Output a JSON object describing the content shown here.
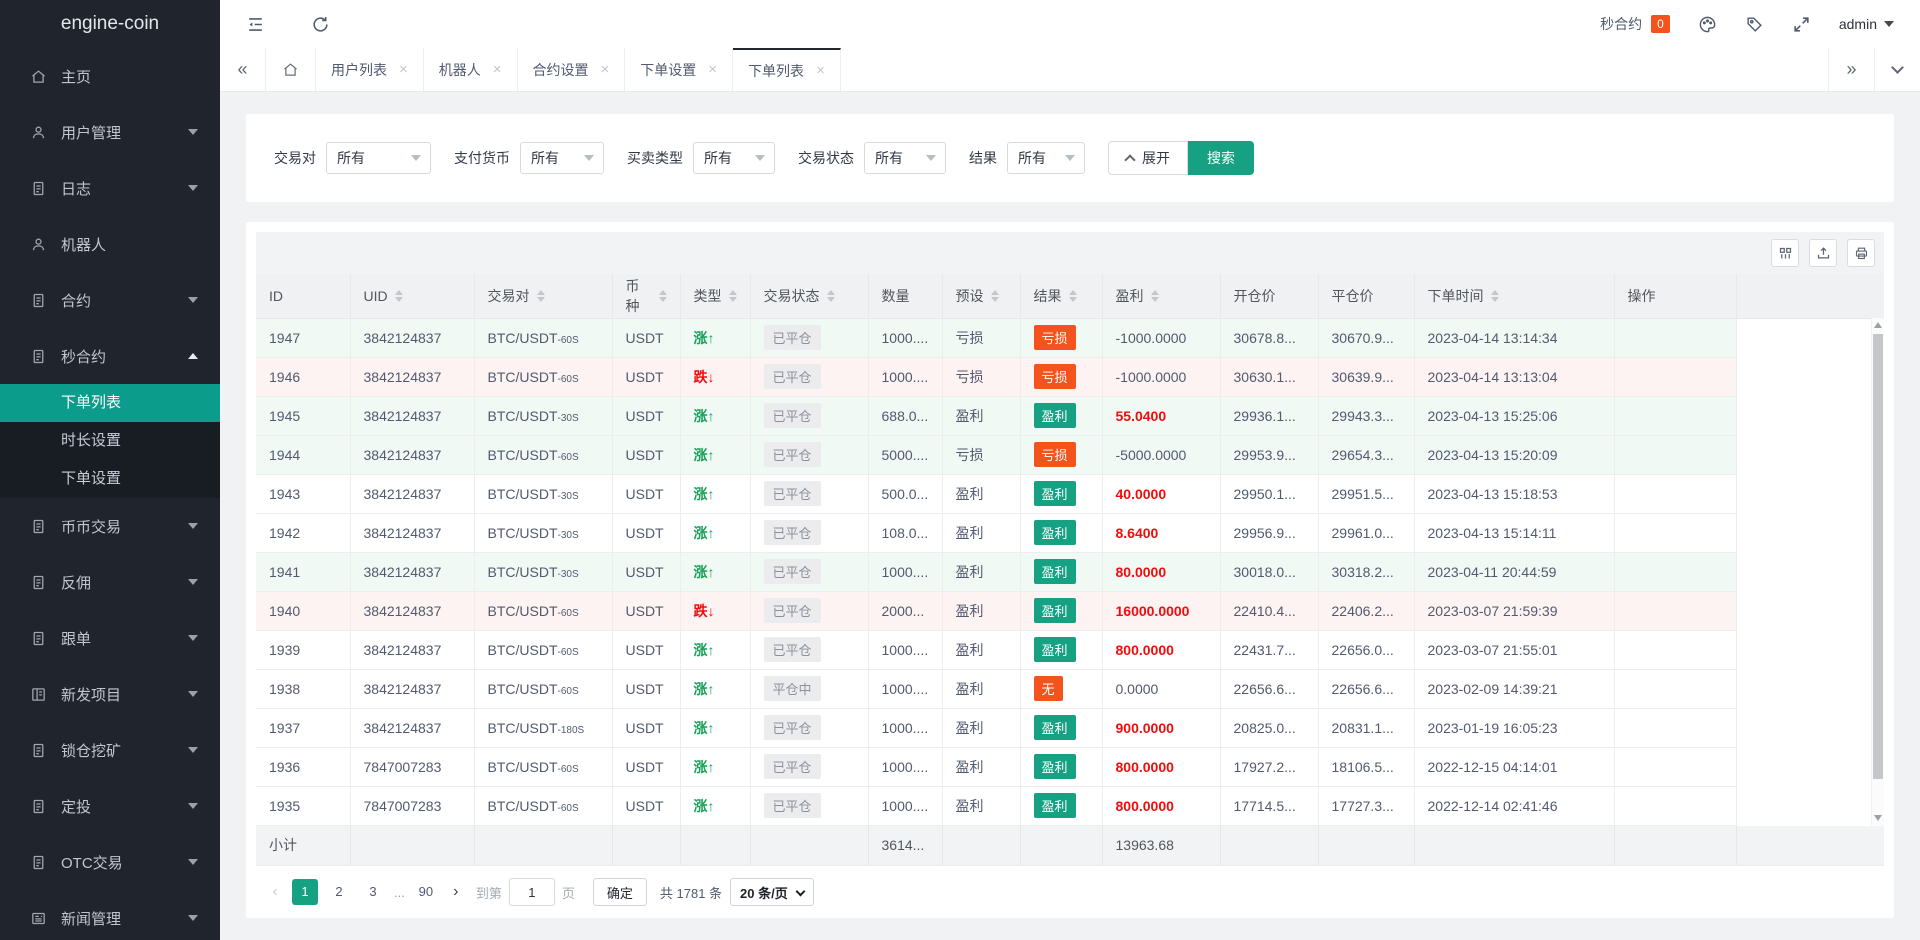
{
  "app": {
    "logo": "engine-coin"
  },
  "colors": {
    "teal": "#15a182",
    "sidebar_active": "#0c9c8c",
    "orange": "#f5531d",
    "red": "#f20c0c",
    "green": "#18a058",
    "tint_green": "#f0f9f4",
    "tint_pink": "#fdf3f2",
    "tab_active_bar": "#23262d"
  },
  "topbar": {
    "notice": {
      "label": "秒合约",
      "count": "0"
    },
    "user": {
      "name": "admin"
    }
  },
  "tabbar": {
    "tabs": [
      {
        "key": "user-list",
        "label": "用户列表",
        "active": false
      },
      {
        "key": "robots",
        "label": "机器人",
        "active": false
      },
      {
        "key": "contract-settings",
        "label": "合约设置",
        "active": false
      },
      {
        "key": "order-settings",
        "label": "下单设置",
        "active": false
      },
      {
        "key": "order-list",
        "label": "下单列表",
        "active": true
      }
    ]
  },
  "sidebar": {
    "items": [
      {
        "key": "home",
        "label": "主页",
        "icon": "home-icon",
        "expandable": false
      },
      {
        "key": "user-management",
        "label": "用户管理",
        "icon": "user-icon",
        "expandable": true
      },
      {
        "key": "logs",
        "label": "日志",
        "icon": "doc-icon",
        "expandable": true
      },
      {
        "key": "robots",
        "label": "机器人",
        "icon": "user-icon",
        "expandable": false
      },
      {
        "key": "contracts",
        "label": "合约",
        "icon": "doc-icon",
        "expandable": true
      },
      {
        "key": "second-contracts",
        "label": "秒合约",
        "icon": "doc-icon",
        "expandable": true,
        "expanded": true,
        "children": [
          {
            "key": "order-list",
            "label": "下单列表",
            "active": true
          },
          {
            "key": "duration-settings",
            "label": "时长设置",
            "active": false
          },
          {
            "key": "order-settings",
            "label": "下单设置",
            "active": false
          }
        ]
      },
      {
        "key": "spot-trading",
        "label": "币币交易",
        "icon": "doc-icon",
        "expandable": true
      },
      {
        "key": "rebate",
        "label": "反佣",
        "icon": "doc-icon",
        "expandable": true
      },
      {
        "key": "copy-trading",
        "label": "跟单",
        "icon": "doc-icon",
        "expandable": true
      },
      {
        "key": "new-projects",
        "label": "新发项目",
        "icon": "project-icon",
        "expandable": true
      },
      {
        "key": "lock-mining",
        "label": "锁仓挖矿",
        "icon": "doc-icon",
        "expandable": true
      },
      {
        "key": "auto-invest",
        "label": "定投",
        "icon": "doc-icon",
        "expandable": true
      },
      {
        "key": "otc-trading",
        "label": "OTC交易",
        "icon": "doc-icon",
        "expandable": true
      },
      {
        "key": "news-management",
        "label": "新闻管理",
        "icon": "news-icon",
        "expandable": true
      }
    ]
  },
  "filters": {
    "fields": [
      {
        "key": "pair",
        "label": "交易对",
        "value": "所有"
      },
      {
        "key": "pay-currency",
        "label": "支付货币",
        "value": "所有"
      },
      {
        "key": "trade-type",
        "label": "买卖类型",
        "value": "所有"
      },
      {
        "key": "trade-status",
        "label": "交易状态",
        "value": "所有"
      },
      {
        "key": "result",
        "label": "结果",
        "value": "所有"
      }
    ],
    "collapse_label": "展开",
    "search_label": "搜索"
  },
  "table": {
    "columns": [
      {
        "key": "id",
        "label": "ID",
        "sortable": false
      },
      {
        "key": "uid",
        "label": "UID",
        "sortable": true
      },
      {
        "key": "pair",
        "label": "交易对",
        "sortable": true
      },
      {
        "key": "coin",
        "label": "币种",
        "sortable": true
      },
      {
        "key": "type",
        "label": "类型",
        "sortable": true
      },
      {
        "key": "status",
        "label": "交易状态",
        "sortable": true
      },
      {
        "key": "amount",
        "label": "数量",
        "sortable": false
      },
      {
        "key": "preset",
        "label": "预设",
        "sortable": true
      },
      {
        "key": "result",
        "label": "结果",
        "sortable": true
      },
      {
        "key": "profit",
        "label": "盈利",
        "sortable": true
      },
      {
        "key": "open",
        "label": "开仓价",
        "sortable": false
      },
      {
        "key": "close",
        "label": "平仓价",
        "sortable": false
      },
      {
        "key": "time",
        "label": "下单时间",
        "sortable": true
      },
      {
        "key": "action",
        "label": "操作",
        "sortable": false
      }
    ],
    "rows": [
      {
        "id": "1947",
        "uid": "3842124837",
        "pair": "BTC/USDT",
        "period": "60S",
        "coin": "USDT",
        "type": "涨",
        "dir": "up",
        "status": "已平仓",
        "amount": "1000....",
        "preset": "亏损",
        "result": "亏损",
        "result_color": "orange",
        "profit": "-1000.0000",
        "profit_red": false,
        "open": "30678.8...",
        "close": "30670.9...",
        "time": "2023-04-14 13:14:34",
        "tint": "green"
      },
      {
        "id": "1946",
        "uid": "3842124837",
        "pair": "BTC/USDT",
        "period": "60S",
        "coin": "USDT",
        "type": "跌",
        "dir": "down",
        "status": "已平仓",
        "amount": "1000....",
        "preset": "亏损",
        "result": "亏损",
        "result_color": "orange",
        "profit": "-1000.0000",
        "profit_red": false,
        "open": "30630.1...",
        "close": "30639.9...",
        "time": "2023-04-14 13:13:04",
        "tint": "pink"
      },
      {
        "id": "1945",
        "uid": "3842124837",
        "pair": "BTC/USDT",
        "period": "30S",
        "coin": "USDT",
        "type": "涨",
        "dir": "up",
        "status": "已平仓",
        "amount": "688.0...",
        "preset": "盈利",
        "result": "盈利",
        "result_color": "teal",
        "profit": "55.0400",
        "profit_red": true,
        "open": "29936.1...",
        "close": "29943.3...",
        "time": "2023-04-13 15:25:06",
        "tint": "green"
      },
      {
        "id": "1944",
        "uid": "3842124837",
        "pair": "BTC/USDT",
        "period": "60S",
        "coin": "USDT",
        "type": "涨",
        "dir": "up",
        "status": "已平仓",
        "amount": "5000....",
        "preset": "亏损",
        "result": "亏损",
        "result_color": "orange",
        "profit": "-5000.0000",
        "profit_red": false,
        "open": "29953.9...",
        "close": "29654.3...",
        "time": "2023-04-13 15:20:09",
        "tint": "green"
      },
      {
        "id": "1943",
        "uid": "3842124837",
        "pair": "BTC/USDT",
        "period": "30S",
        "coin": "USDT",
        "type": "涨",
        "dir": "up",
        "status": "已平仓",
        "amount": "500.0...",
        "preset": "盈利",
        "result": "盈利",
        "result_color": "teal",
        "profit": "40.0000",
        "profit_red": true,
        "open": "29950.1...",
        "close": "29951.5...",
        "time": "2023-04-13 15:18:53",
        "tint": "white"
      },
      {
        "id": "1942",
        "uid": "3842124837",
        "pair": "BTC/USDT",
        "period": "30S",
        "coin": "USDT",
        "type": "涨",
        "dir": "up",
        "status": "已平仓",
        "amount": "108.0...",
        "preset": "盈利",
        "result": "盈利",
        "result_color": "teal",
        "profit": "8.6400",
        "profit_red": true,
        "open": "29956.9...",
        "close": "29961.0...",
        "time": "2023-04-13 15:14:11",
        "tint": "white"
      },
      {
        "id": "1941",
        "uid": "3842124837",
        "pair": "BTC/USDT",
        "period": "30S",
        "coin": "USDT",
        "type": "涨",
        "dir": "up",
        "status": "已平仓",
        "amount": "1000....",
        "preset": "盈利",
        "result": "盈利",
        "result_color": "teal",
        "profit": "80.0000",
        "profit_red": true,
        "open": "30018.0...",
        "close": "30318.2...",
        "time": "2023-04-11 20:44:59",
        "tint": "green"
      },
      {
        "id": "1940",
        "uid": "3842124837",
        "pair": "BTC/USDT",
        "period": "60S",
        "coin": "USDT",
        "type": "跌",
        "dir": "down",
        "status": "已平仓",
        "amount": "2000...",
        "preset": "盈利",
        "result": "盈利",
        "result_color": "teal",
        "profit": "16000.0000",
        "profit_red": true,
        "open": "22410.4...",
        "close": "22406.2...",
        "time": "2023-03-07 21:59:39",
        "tint": "pink"
      },
      {
        "id": "1939",
        "uid": "3842124837",
        "pair": "BTC/USDT",
        "period": "60S",
        "coin": "USDT",
        "type": "涨",
        "dir": "up",
        "status": "已平仓",
        "amount": "1000....",
        "preset": "盈利",
        "result": "盈利",
        "result_color": "teal",
        "profit": "800.0000",
        "profit_red": true,
        "open": "22431.7...",
        "close": "22656.0...",
        "time": "2023-03-07 21:55:01",
        "tint": "white"
      },
      {
        "id": "1938",
        "uid": "3842124837",
        "pair": "BTC/USDT",
        "period": "60S",
        "coin": "USDT",
        "type": "涨",
        "dir": "up",
        "status": "平仓中",
        "amount": "1000....",
        "preset": "盈利",
        "result": "无",
        "result_color": "orange",
        "profit": "0.0000",
        "profit_red": false,
        "open": "22656.6...",
        "close": "22656.6...",
        "time": "2023-02-09 14:39:21",
        "tint": "white"
      },
      {
        "id": "1937",
        "uid": "3842124837",
        "pair": "BTC/USDT",
        "period": "180S",
        "coin": "USDT",
        "type": "涨",
        "dir": "up",
        "status": "已平仓",
        "amount": "1000....",
        "preset": "盈利",
        "result": "盈利",
        "result_color": "teal",
        "profit": "900.0000",
        "profit_red": true,
        "open": "20825.0...",
        "close": "20831.1...",
        "time": "2023-01-19 16:05:23",
        "tint": "white"
      },
      {
        "id": "1936",
        "uid": "7847007283",
        "pair": "BTC/USDT",
        "period": "60S",
        "coin": "USDT",
        "type": "涨",
        "dir": "up",
        "status": "已平仓",
        "amount": "1000....",
        "preset": "盈利",
        "result": "盈利",
        "result_color": "teal",
        "profit": "800.0000",
        "profit_red": true,
        "open": "17927.2...",
        "close": "18106.5...",
        "time": "2022-12-15 04:14:01",
        "tint": "white"
      },
      {
        "id": "1935",
        "uid": "7847007283",
        "pair": "BTC/USDT",
        "period": "60S",
        "coin": "USDT",
        "type": "涨",
        "dir": "up",
        "status": "已平仓",
        "amount": "1000....",
        "preset": "盈利",
        "result": "盈利",
        "result_color": "teal",
        "profit": "800.0000",
        "profit_red": true,
        "open": "17714.5...",
        "close": "17727.3...",
        "time": "2022-12-14 02:41:46",
        "tint": "white"
      }
    ],
    "subtotal": {
      "label": "小计",
      "amount": "3614...",
      "profit": "13963.68"
    }
  },
  "pagination": {
    "prev": "‹",
    "next": "›",
    "pages": [
      "1",
      "2",
      "3",
      "...",
      "90"
    ],
    "active_page": "1",
    "goto_label": "到第",
    "goto_value": "1",
    "page_unit": "页",
    "confirm_label": "确定",
    "total_label": "共 1781 条",
    "size_label": "20 条/页"
  }
}
